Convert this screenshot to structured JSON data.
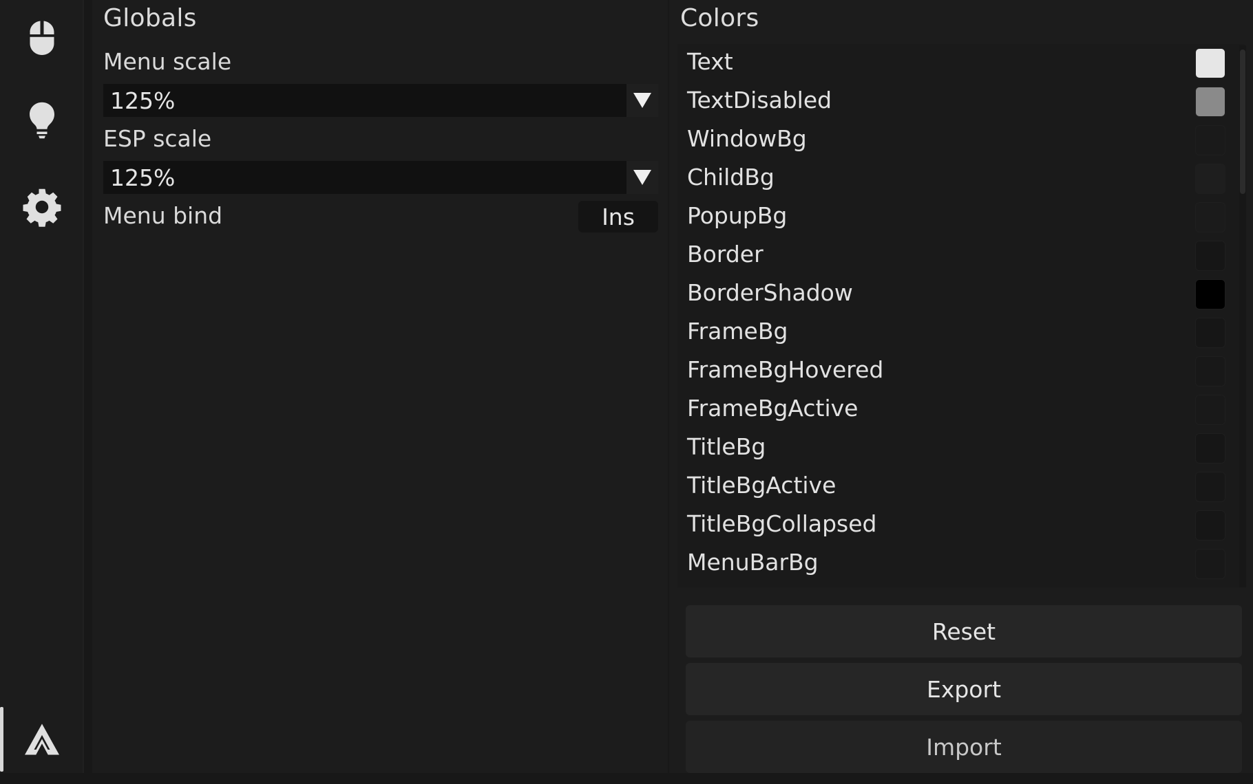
{
  "globals": {
    "title": "Globals",
    "menu_scale_label": "Menu scale",
    "menu_scale_value": "125%",
    "esp_scale_label": "ESP scale",
    "esp_scale_value": "125%",
    "menu_bind_label": "Menu bind",
    "menu_bind_value": "Ins"
  },
  "colors": {
    "title": "Colors",
    "items": [
      {
        "name": "Text",
        "color": "#e6e6e6"
      },
      {
        "name": "TextDisabled",
        "color": "#8a8a8a"
      },
      {
        "name": "WindowBg",
        "color": "#1a1a1a"
      },
      {
        "name": "ChildBg",
        "color": "#1e1e1e"
      },
      {
        "name": "PopupBg",
        "color": "#1b1b1b"
      },
      {
        "name": "Border",
        "color": "#161616"
      },
      {
        "name": "BorderShadow",
        "color": "#000000"
      },
      {
        "name": "FrameBg",
        "color": "#161616"
      },
      {
        "name": "FrameBgHovered",
        "color": "#181818"
      },
      {
        "name": "FrameBgActive",
        "color": "#191919"
      },
      {
        "name": "TitleBg",
        "color": "#161616"
      },
      {
        "name": "TitleBgActive",
        "color": "#171717"
      },
      {
        "name": "TitleBgCollapsed",
        "color": "#161616"
      },
      {
        "name": "MenuBarBg",
        "color": "#181818"
      }
    ]
  },
  "buttons": {
    "reset": "Reset",
    "export": "Export",
    "import": "Import"
  },
  "sidebar": {
    "items": [
      {
        "icon": "mouse-icon"
      },
      {
        "icon": "lightbulb-icon"
      },
      {
        "icon": "gear-icon"
      },
      {
        "icon": "logo-icon"
      }
    ]
  }
}
